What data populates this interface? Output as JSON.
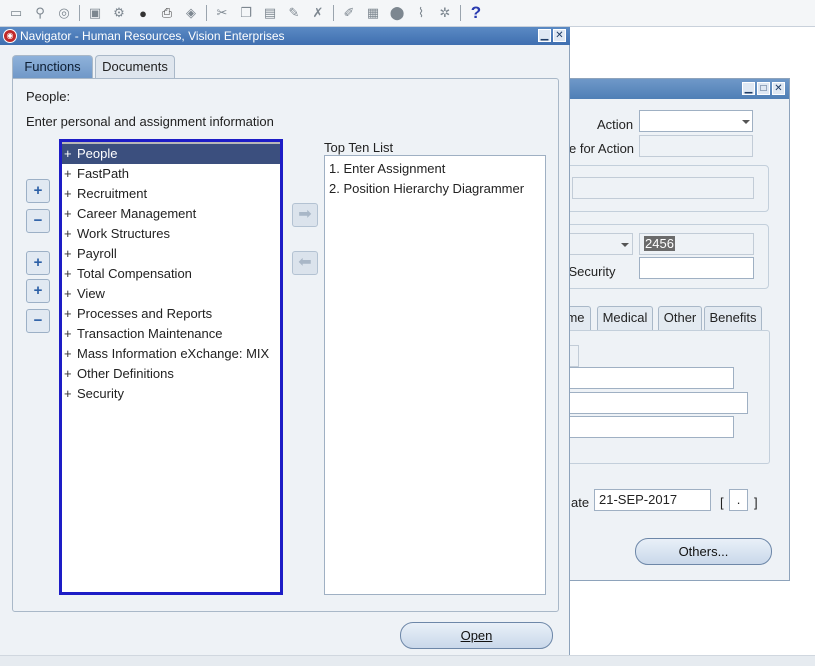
{
  "toolbar": {
    "icons": [
      "new-icon",
      "find-icon",
      "globe-icon",
      "save-icon",
      "next-step-icon",
      "switch-responsibility-icon",
      "print-icon",
      "close-form-icon",
      "cut-icon",
      "copy-icon",
      "paste-icon",
      "clear-record-icon",
      "delete-record-icon",
      "edit-field-icon",
      "zoom-icon",
      "translations-icon",
      "attachments-icon",
      "folder-tools-icon",
      "help-icon"
    ],
    "help_glyph": "?"
  },
  "navigator": {
    "title": "Navigator - Human Resources, Vision Enterprises",
    "minimize": "▁",
    "close": "✕",
    "tabs": [
      {
        "label": "Functions",
        "active": true
      },
      {
        "label": "Documents",
        "active": false
      }
    ],
    "context_label": "People:",
    "description": "Enter personal and assignment information",
    "tree_items": [
      {
        "label": "People",
        "selected": true
      },
      {
        "label": "FastPath"
      },
      {
        "label": "Recruitment"
      },
      {
        "label": "Career Management"
      },
      {
        "label": "Work Structures"
      },
      {
        "label": "Payroll"
      },
      {
        "label": "Total Compensation"
      },
      {
        "label": "View"
      },
      {
        "label": "Processes and Reports"
      },
      {
        "label": "Transaction Maintenance"
      },
      {
        "label": "Mass Information eXchange: MIX"
      },
      {
        "label": "Other Definitions"
      },
      {
        "label": "Security"
      }
    ],
    "tree_prefix": "+",
    "side_buttons": {
      "expand": "+",
      "collapse": "−",
      "expand_branch": "+",
      "expand_all": "+",
      "collapse_all": "−"
    },
    "move_buttons": {
      "add": "➡",
      "remove": "⬅"
    },
    "top_ten_label": "Top Ten List",
    "top_ten_items": [
      "1. Enter Assignment",
      "2. Position Hierarchy Diagrammer"
    ],
    "open_button": {
      "label": "Open"
    }
  },
  "background_form": {
    "action_label": "Action",
    "reason_label": "e for Action",
    "number_value": "2456",
    "security_label": "l Security",
    "tabs": [
      "me",
      "Medical",
      "Other",
      "Benefits"
    ],
    "date_label": "ate",
    "date_value": "21-SEP-2017",
    "bracket_open": "[",
    "bracket_dot": ".",
    "bracket_close": "]",
    "others_button": "Others...",
    "minimize": "▁",
    "maximize": "□",
    "close": "✕"
  }
}
